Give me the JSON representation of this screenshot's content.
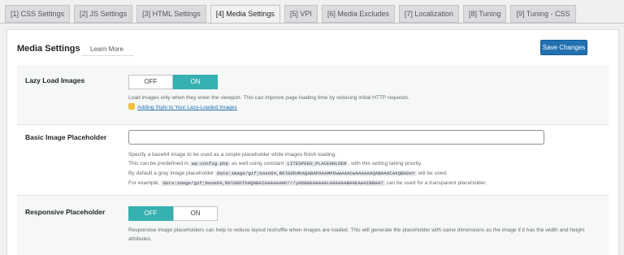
{
  "tabs": [
    {
      "label": "[1] CSS Settings",
      "active": false
    },
    {
      "label": "[2] JS Settings",
      "active": false
    },
    {
      "label": "[3] HTML Settings",
      "active": false
    },
    {
      "label": "[4] Media Settings",
      "active": true
    },
    {
      "label": "[5] VPI",
      "active": false
    },
    {
      "label": "[6] Media Excludes",
      "active": false
    },
    {
      "label": "[7] Localization",
      "active": false
    },
    {
      "label": "[8] Tuning",
      "active": false
    },
    {
      "label": "[9] Tuning - CSS",
      "active": false
    }
  ],
  "header": {
    "title": "Media Settings",
    "learn_more": "Learn More",
    "save_label": "Save Changes"
  },
  "lazy_load": {
    "label": "Lazy Load Images",
    "off": "OFF",
    "on": "ON",
    "selected": "ON",
    "desc": "Load images only when they enter the viewport. This can improve page loading time by reducing initial HTTP requests.",
    "link": "Adding Style to Your Lazy-Loaded Images"
  },
  "basic_placeholder": {
    "label": "Basic Image Placeholder",
    "value": "",
    "line1": "Specify a base64 image to be used as a simple placeholder while images finish loading.",
    "line2_a": "This can be predefined in",
    "line2_code1": "wp-config.php",
    "line2_b": "as well using constant",
    "line2_code2": "LITESPEED_PLACEHOLDER",
    "line2_c": ", with this setting taking priority.",
    "line3_a": "By default a gray image placeholder",
    "line3_code": "data:image/gif;base64,R0lGODdhAQABAPAAAMPDwwAAACwAAAAAAQABAAACAkQBADs=",
    "line3_b": "will be used.",
    "line4_a": "For example,",
    "line4_code": "data:image/gif;base64,R0lGODlhAQABAIAAAAAAAP///yH5BAEAAAAALAAAAAABAAEAAAIBRAA7",
    "line4_b": "can be used for a transparent placeholder."
  },
  "responsive": {
    "label": "Responsive Placeholder",
    "off": "OFF",
    "on": "ON",
    "selected": "OFF",
    "desc1": "Responsive image placeholders can help to reduce layout reshuffle when images are loaded. This will generate the placeholder with same dimensions as the image if it has the width and height",
    "desc2": "attributes."
  }
}
